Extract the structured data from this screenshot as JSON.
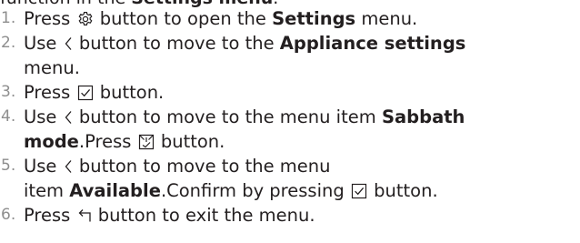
{
  "cut_line": {
    "text_pre": "function in the ",
    "bold": "Settings menu",
    "text_post": "."
  },
  "steps": [
    {
      "num": "1.",
      "t1": "Press",
      "icon": "gear-icon",
      "t2": "button to open the",
      "bold": "Settings",
      "t3": "menu."
    },
    {
      "num": "2.",
      "t1": "Use",
      "icon": "chevron-left-icon",
      "t2": "button to move to the",
      "bold": "Appliance settings",
      "line2": "menu."
    },
    {
      "num": "3.",
      "t1": "Press",
      "icon": "checkbox-check-icon",
      "t2": "button."
    },
    {
      "num": "4.",
      "t1": "Use",
      "icon": "chevron-left-icon",
      "t2": "button to move to the menu item",
      "bold_a": "Sabbath",
      "bold_b": "mode",
      "t3": ".Press",
      "icon2": "sabbath-mode-icon",
      "t4": "button."
    },
    {
      "num": "5.",
      "t1": "Use",
      "icon": "chevron-left-icon",
      "t2": "button to move to the menu",
      "t3": "item",
      "bold": "Available",
      "t4": ".Confirm by pressing",
      "icon2": "checkbox-check-icon",
      "t5": "button."
    },
    {
      "num": "6.",
      "t1": "Press",
      "icon": "back-arrow-icon",
      "t2": "button to exit the menu."
    }
  ],
  "colors": {
    "text": "#231f20",
    "step_number": "#8e8e8e"
  }
}
